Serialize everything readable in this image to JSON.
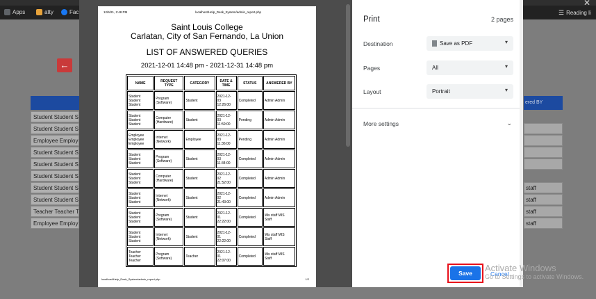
{
  "browser": {
    "bookmarks": [
      {
        "label": "Apps",
        "color": "#5f6368"
      },
      {
        "label": "atty",
        "color": "#e8a33b"
      },
      {
        "label": "Fac",
        "color": "#1877f2"
      }
    ],
    "reading_list": "Reading li",
    "close_glyph": "✕"
  },
  "background_app": {
    "back_glyph": "←",
    "rows_left": [
      "Student Student S",
      "Student Student S",
      "Employee Employee",
      "Student Student S",
      "Student Student S",
      "Student Student S",
      "Student Student S",
      "Student Student S",
      "Teacher Teacher T",
      "Employee Employ"
    ],
    "header_right": "ered BY",
    "rows_right": [
      "",
      "",
      "",
      "",
      "",
      "staff",
      "staff",
      "staff",
      "staff",
      ""
    ]
  },
  "print_preview": {
    "header_left": "12/6/21, 2:48 PM",
    "header_center": "localhost/Help_Desk_System/admin_report.php",
    "college_name": "Saint Louis College",
    "college_address": "Carlatan, City of San Fernando, La Union",
    "report_title": "LIST OF ANSWERED QUERIES",
    "date_range": "2021-12-01 14:48 pm - 2021-12-31 14:48 pm",
    "columns": [
      "NAME",
      "REQUEST TYPE",
      "CATEGORY",
      "DATE & TIME",
      "STATUS",
      "ANSWERED BY"
    ],
    "rows": [
      [
        "Student\nStudent\nStudent",
        "Program\n(Software)",
        "Student",
        "2021-12-\n03\n12:26:00",
        "Completed",
        "Admin Admin"
      ],
      [
        "Student\nStudent\nStudent",
        "Computer\n(Hardware)",
        "Student",
        "2021-12-\n03\n11:59:00",
        "Pending",
        "Admin Admin"
      ],
      [
        "Employee\nEmployee\nEmployee",
        "Internet\n(Network)",
        "Employee",
        "2021-12-\n03\n11:36:00",
        "Pending",
        "Admin Admin"
      ],
      [
        "Student\nStudent\nStudent",
        "Program\n(Software)",
        "Student",
        "2021-12-\n03\n11:34:00",
        "Completed",
        "Admin Admin"
      ],
      [
        "Student\nStudent\nStudent",
        "Computer\n(Hardware)",
        "Student",
        "2021-12-\n02\n21:52:00",
        "Completed",
        "Admin Admin"
      ],
      [
        "Student\nStudent\nStudent",
        "Internet\n(Network)",
        "Student",
        "2021-12-\n02\n21:43:00",
        "Completed",
        "Admin Admin"
      ],
      [
        "Student\nStudent\nStudent",
        "Program\n(Software)",
        "Student",
        "2021-12-\n01\n22:22:00",
        "Completed",
        "Mis staff MIS\nStaff"
      ],
      [
        "Student\nStudent\nStudent",
        "Internet\n(Network)",
        "Student",
        "2021-12-\n01\n22:22:00",
        "Completed",
        "Mis staff MIS\nStaff"
      ],
      [
        "Teacher\nTeacher\nTeacher",
        "Program\n(Software)",
        "Teacher",
        "2021-12-\n01\n22:07:00",
        "Completed",
        "Mis staff MIS\nStaff"
      ]
    ],
    "footer_left": "localhost/Help_Desk_System/admin_report.php",
    "footer_right": "1/2"
  },
  "print_panel": {
    "title": "Print",
    "page_count": "2 pages",
    "destination_label": "Destination",
    "destination_value": "Save as PDF",
    "pages_label": "Pages",
    "pages_value": "All",
    "layout_label": "Layout",
    "layout_value": "Portrait",
    "more_settings": "More settings",
    "save": "Save",
    "cancel": "Cancel",
    "chevron_glyph": "▾",
    "expand_glyph": "⌄"
  },
  "watermark": {
    "line1": "Activate Windows",
    "line2": "Go to Settings to activate Windows."
  }
}
